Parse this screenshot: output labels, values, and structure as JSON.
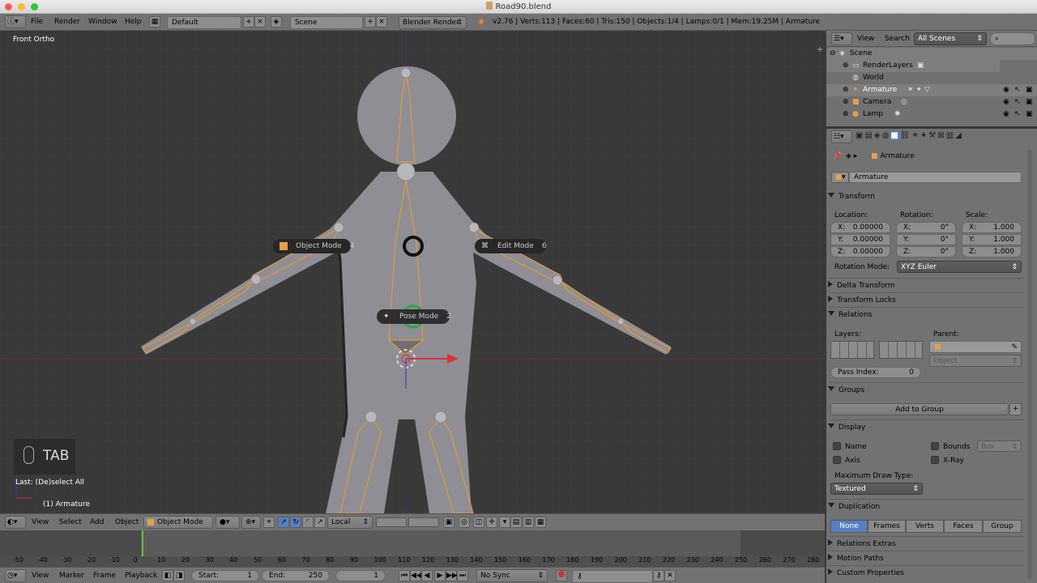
{
  "window": {
    "title": "Road90.blend"
  },
  "info_header": {
    "menus": [
      "File",
      "Render",
      "Window",
      "Help"
    ],
    "screen_layout": "Default",
    "scene": "Scene",
    "render_engine": "Blender Render",
    "stats": "v2.76 | Verts:113 | Faces:60 | Tris:150 | Objects:1/4 | Lamps:0/1 | Mem:19.25M | Armature"
  },
  "viewport": {
    "view_label": "Front Ortho",
    "key_hint": "TAB",
    "last_op": "Last: (De)select All",
    "object_label": "(1) Armature",
    "pie": {
      "object_mode": {
        "label": "Object Mode",
        "num": "4"
      },
      "edit_mode": {
        "label": "Edit Mode",
        "num": "6"
      },
      "pose_mode": {
        "label": "Pose Mode",
        "num": "2"
      }
    }
  },
  "view3d_header": {
    "menus": [
      "View",
      "Select",
      "Add",
      "Object"
    ],
    "mode": "Object Mode",
    "orientation": "Local"
  },
  "timeline": {
    "ticks": [
      "-50",
      "-40",
      "-30",
      "-20",
      "-10",
      "0",
      "10",
      "20",
      "30",
      "40",
      "50",
      "60",
      "70",
      "80",
      "90",
      "100",
      "110",
      "120",
      "130",
      "140",
      "150",
      "160",
      "170",
      "180",
      "190",
      "200",
      "210",
      "220",
      "230",
      "240",
      "250",
      "260",
      "270",
      "280"
    ],
    "menus": [
      "View",
      "Marker",
      "Frame",
      "Playback"
    ],
    "start_label": "Start:",
    "start": "1",
    "end_label": "End:",
    "end": "250",
    "current": "1",
    "sync": "No Sync"
  },
  "outliner": {
    "menus": [
      "View",
      "Search"
    ],
    "filter": "All Scenes",
    "items": [
      "Scene",
      "RenderLayers",
      "World",
      "Armature",
      "Camera",
      "Lamp"
    ]
  },
  "properties": {
    "breadcrumb": "Armature",
    "object_name": "Armature",
    "transform": {
      "title": "Transform",
      "location_label": "Location:",
      "rotation_label": "Rotation:",
      "scale_label": "Scale:",
      "location": [
        {
          "axis": "X:",
          "value": "0.00000"
        },
        {
          "axis": "Y:",
          "value": "0.00000"
        },
        {
          "axis": "Z:",
          "value": "0.00000"
        }
      ],
      "rotation": [
        {
          "axis": "X:",
          "value": "0°"
        },
        {
          "axis": "Y:",
          "value": "0°"
        },
        {
          "axis": "Z:",
          "value": "0°"
        }
      ],
      "scale": [
        {
          "axis": "X:",
          "value": "1.000"
        },
        {
          "axis": "Y:",
          "value": "1.000"
        },
        {
          "axis": "Z:",
          "value": "1.000"
        }
      ],
      "rotation_mode_label": "Rotation Mode:",
      "rotation_mode": "XYZ Euler"
    },
    "delta_transform": "Delta Transform",
    "transform_locks": "Transform Locks",
    "relations": {
      "title": "Relations",
      "layers_label": "Layers:",
      "parent_label": "Parent:",
      "parent_type": "Object",
      "pass_index_label": "Pass Index:",
      "pass_index": "0"
    },
    "groups": {
      "title": "Groups",
      "add_button": "Add to Group"
    },
    "display": {
      "title": "Display",
      "name": "Name",
      "axis": "Axis",
      "bounds": "Bounds",
      "bounds_type": "Box",
      "xray": "X-Ray",
      "max_draw_label": "Maximum Draw Type:",
      "max_draw": "Textured"
    },
    "duplication": {
      "title": "Duplication",
      "tabs": [
        "None",
        "Frames",
        "Verts",
        "Faces",
        "Group"
      ],
      "active": "None"
    },
    "relations_extras": "Relations Extras",
    "motion_paths": "Motion Paths",
    "custom_properties": "Custom Properties"
  }
}
